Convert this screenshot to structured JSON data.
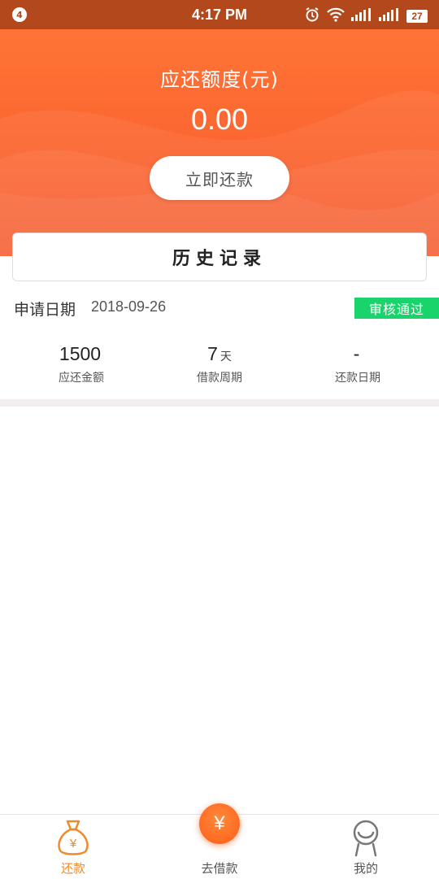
{
  "status_bar": {
    "notification_count": "4",
    "time": "4:17 PM",
    "battery": "27",
    "icons": [
      "alarm-icon",
      "wifi-icon",
      "signal-icon",
      "signal-icon",
      "battery-icon"
    ]
  },
  "hero": {
    "label": "应还额度(元)",
    "amount": "0.00",
    "repay_button": "立即还款"
  },
  "history": {
    "title": "历史记录"
  },
  "record": {
    "apply_label": "申请日期",
    "apply_date": "2018-09-26",
    "status": "审核通过",
    "stats": [
      {
        "value": "1500",
        "unit": "",
        "label": "应还金额"
      },
      {
        "value": "7",
        "unit": "天",
        "label": "借款周期"
      },
      {
        "value": "-",
        "unit": "",
        "label": "还款日期"
      }
    ]
  },
  "tabbar": {
    "tabs": [
      {
        "label": "还款",
        "icon": "money-bag-icon",
        "active": true
      },
      {
        "label": "去借款",
        "icon": "yuan-icon",
        "active": false
      },
      {
        "label": "我的",
        "icon": "person-icon",
        "active": false
      }
    ],
    "borrow_symbol": "¥",
    "bag_symbol": "¥"
  },
  "colors": {
    "accent": "#fb6530",
    "status_bar": "#b3481c",
    "approved": "#19d36b",
    "tab_active": "#f08a2c"
  }
}
